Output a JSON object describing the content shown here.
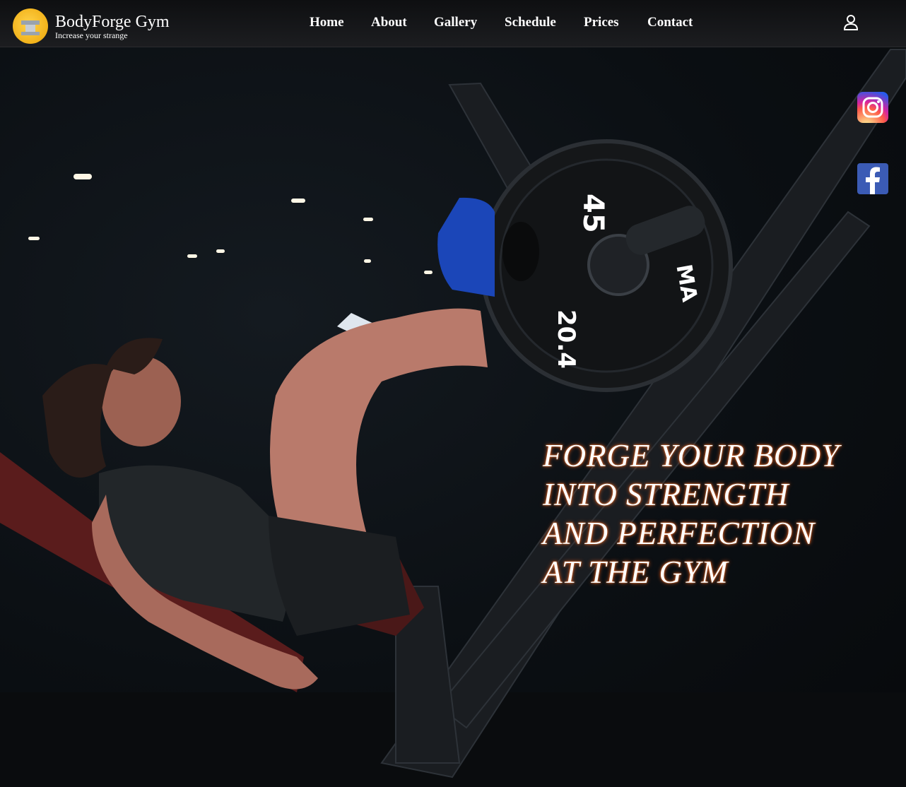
{
  "header": {
    "brand_title": "BodyForge Gym",
    "brand_subtitle": "Increase your strange",
    "nav": [
      "Home",
      "About",
      "Gallery",
      "Schedule",
      "Prices",
      "Contact"
    ]
  },
  "hero": {
    "headline": "FORGE YOUR BODY INTO STRENGTH AND PERFECTION AT THE GYM",
    "plate_numbers": [
      "45",
      "20.4"
    ],
    "plate_brand": "MA"
  },
  "social": {
    "icons": [
      "instagram-icon",
      "facebook-icon"
    ]
  },
  "colors": {
    "header_bg": "#1c1d20",
    "logo_yellow": "#f2b21a",
    "headline_glow": "#e05a1e",
    "facebook_blue": "#3b5bb5"
  }
}
